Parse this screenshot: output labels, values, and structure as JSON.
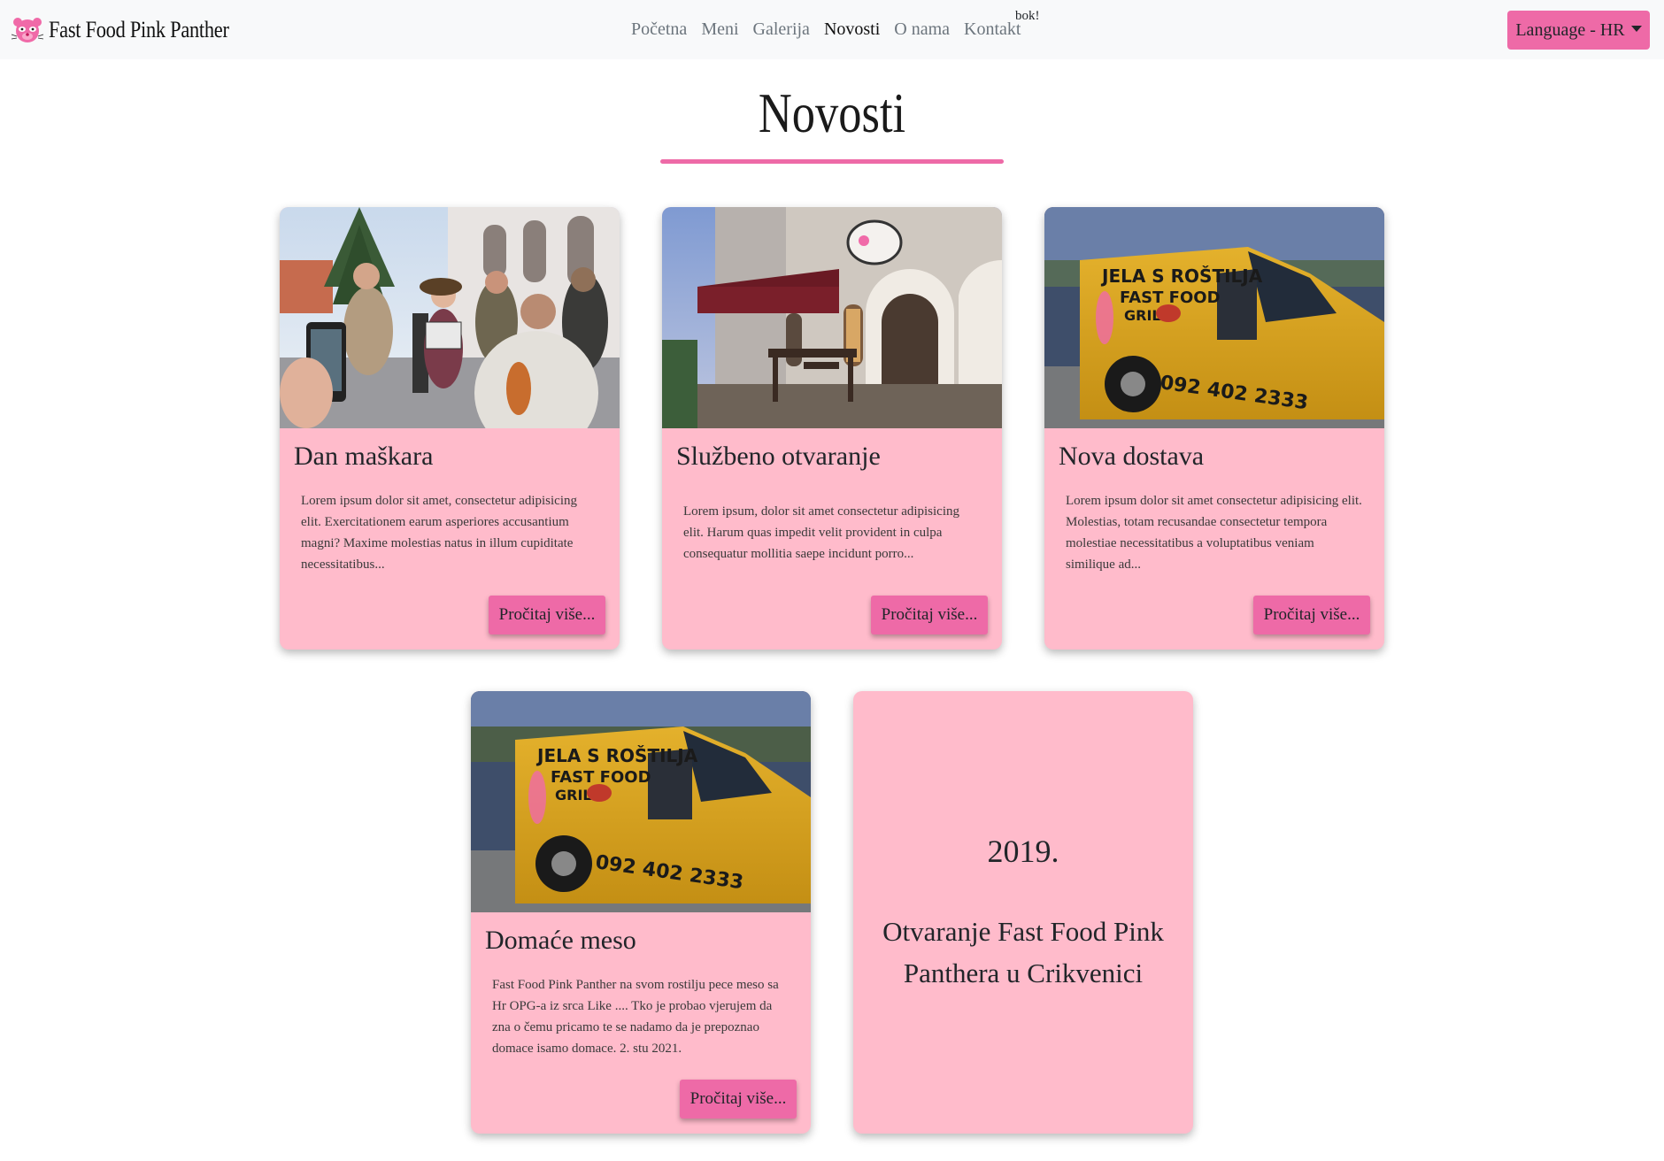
{
  "colors": {
    "brand_pink": "#ee6aa7",
    "card_pink": "#ffbbcb",
    "navbar_bg": "#f8f9fa"
  },
  "navbar": {
    "logo_icon": "pink-panther-logo-icon",
    "brand": "Fast Food Pink Panther",
    "links": [
      {
        "label": "Početna",
        "active": false
      },
      {
        "label": "Meni",
        "active": false
      },
      {
        "label": "Galerija",
        "active": false
      },
      {
        "label": "Novosti",
        "active": true
      },
      {
        "label": "O nama",
        "active": false
      },
      {
        "label": "Kontakt",
        "active": false
      }
    ],
    "sup_text": "bok!",
    "language_button": "Language - HR",
    "language_icon": "caret-down-icon"
  },
  "page": {
    "title": "Novosti"
  },
  "news": [
    {
      "title": "Dan maškara",
      "text": "Lorem ipsum dolor sit amet, consectetur adipisicing elit. Exercitationem earum asperiores accusantium magni? Maxime molestias natus in illum cupiditate necessitatibus...",
      "button": "Pročitaj više...",
      "image": "carnival-street-photo"
    },
    {
      "title": "Službeno otvaranje",
      "text": "Lorem ipsum, dolor sit amet consectetur adipisicing elit. Harum quas impedit velit provident in culpa consequatur mollitia saepe incidunt porro...",
      "button": "Pročitaj više...",
      "image": "restaurant-storefront-photo"
    },
    {
      "title": "Nova dostava",
      "text": "Lorem ipsum dolor sit amet consectetur adipisicing elit. Molestias, totam recusandae consectetur tempora molestiae necessitatibus a voluptatibus veniam similique ad...",
      "button": "Pročitaj više...",
      "image": "delivery-van-photo"
    },
    {
      "title": "Domaće meso",
      "text": "Fast Food Pink Panther na svom rostilju pece meso sa Hr OPG-a iz srca Like .... Tko je probao vjerujem da zna o čemu pricamo te se nadamo da je prepoznao domace isamo domace. 2. stu 2021.",
      "button": "Pročitaj više...",
      "image": "delivery-van-photo"
    }
  ],
  "year_card": {
    "year": "2019.",
    "caption": "Otvaranje Fast Food Pink Panthera u Crikvenici"
  },
  "van_text": {
    "line1": "JELA S ROŠTILJA",
    "line2": "FAST FOOD",
    "line3": "GRILL",
    "phone": "092 402 2333"
  }
}
